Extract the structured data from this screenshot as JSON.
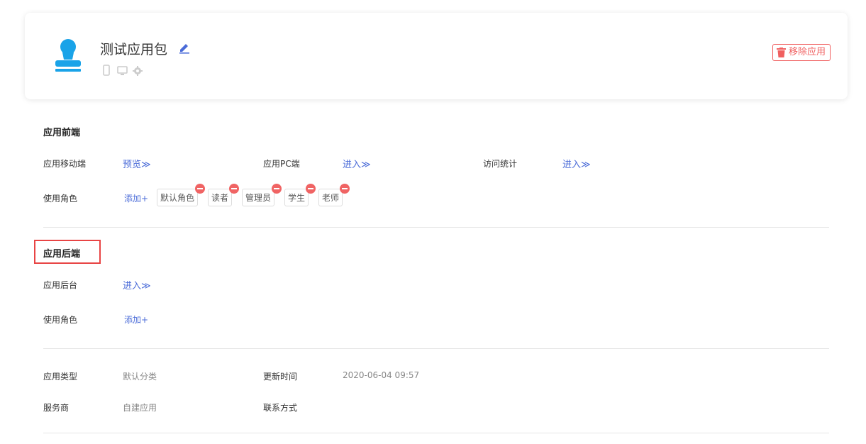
{
  "header": {
    "app_name": "测试应用包",
    "remove_label": "移除应用",
    "icons": [
      "avatar-icon",
      "edit-icon",
      "mobile-icon",
      "monitor-icon",
      "gear-icon",
      "trash-icon"
    ]
  },
  "frontend": {
    "title": "应用前端",
    "mobile_label": "应用移动端",
    "mobile_link": "预览≫",
    "pc_label": "应用PC端",
    "pc_link": "进入≫",
    "stats_label": "访问统计",
    "stats_link": "进入≫",
    "roles_label": "使用角色",
    "add_label": "添加+",
    "roles": [
      "默认角色",
      "读者",
      "管理员",
      "学生",
      "老师"
    ]
  },
  "backend": {
    "title": "应用后端",
    "admin_label": "应用后台",
    "admin_link": "进入≫",
    "roles_label": "使用角色",
    "add_label": "添加+"
  },
  "info": {
    "type_label": "应用类型",
    "type_value": "默认分类",
    "updated_label": "更新时间",
    "updated_value": "2020-06-04 09:57",
    "provider_label": "服务商",
    "provider_value": "自建应用",
    "contact_label": "联系方式"
  },
  "colors": {
    "accent": "#4a6bd8",
    "danger": "#f06060",
    "avatar": "#1aa3e8",
    "highlight": "#e84444"
  }
}
